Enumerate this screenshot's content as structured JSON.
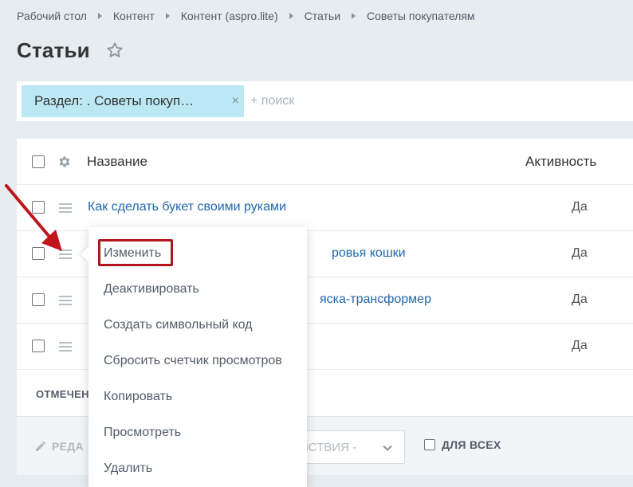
{
  "breadcrumb": [
    "Рабочий стол",
    "Контент",
    "Контент (aspro.lite)",
    "Статьи",
    "Советы покупателям"
  ],
  "page": {
    "title": "Статьи"
  },
  "filter": {
    "chip_label": "Раздел: . Советы покуп…",
    "chip_close": "×",
    "search_placeholder": "+ поиск"
  },
  "grid": {
    "columns": {
      "name": "Название",
      "active": "Активность"
    },
    "rows": [
      {
        "name": "Как сделать букет своими руками",
        "active": "Да"
      },
      {
        "name": "ровья кошки",
        "active": "Да"
      },
      {
        "name": "яска-трансформер",
        "active": "Да"
      },
      {
        "name": "",
        "active": "Да"
      }
    ],
    "selected_label": "ОТМЕЧЕН"
  },
  "actionbar": {
    "edit_label": "РЕДА",
    "actions_select": "ЙСТВИЯ -",
    "for_all_label": "ДЛЯ ВСЕХ"
  },
  "context_menu": {
    "items": [
      "Изменить",
      "Деактивировать",
      "Создать символьный код",
      "Сбросить счетчик просмотров",
      "Копировать",
      "Просмотреть",
      "Удалить"
    ]
  },
  "colors": {
    "background": "#e6ecef",
    "link": "#2067b0",
    "chip": "#bce8f5",
    "highlight": "#b0161c"
  },
  "icons": {
    "favorite": "star-icon",
    "settings": "gear-icon",
    "drag": "drag-handle-icon",
    "edit": "pencil-icon",
    "chevron": "chevron-down-icon",
    "annotation": "red-arrow-icon"
  }
}
